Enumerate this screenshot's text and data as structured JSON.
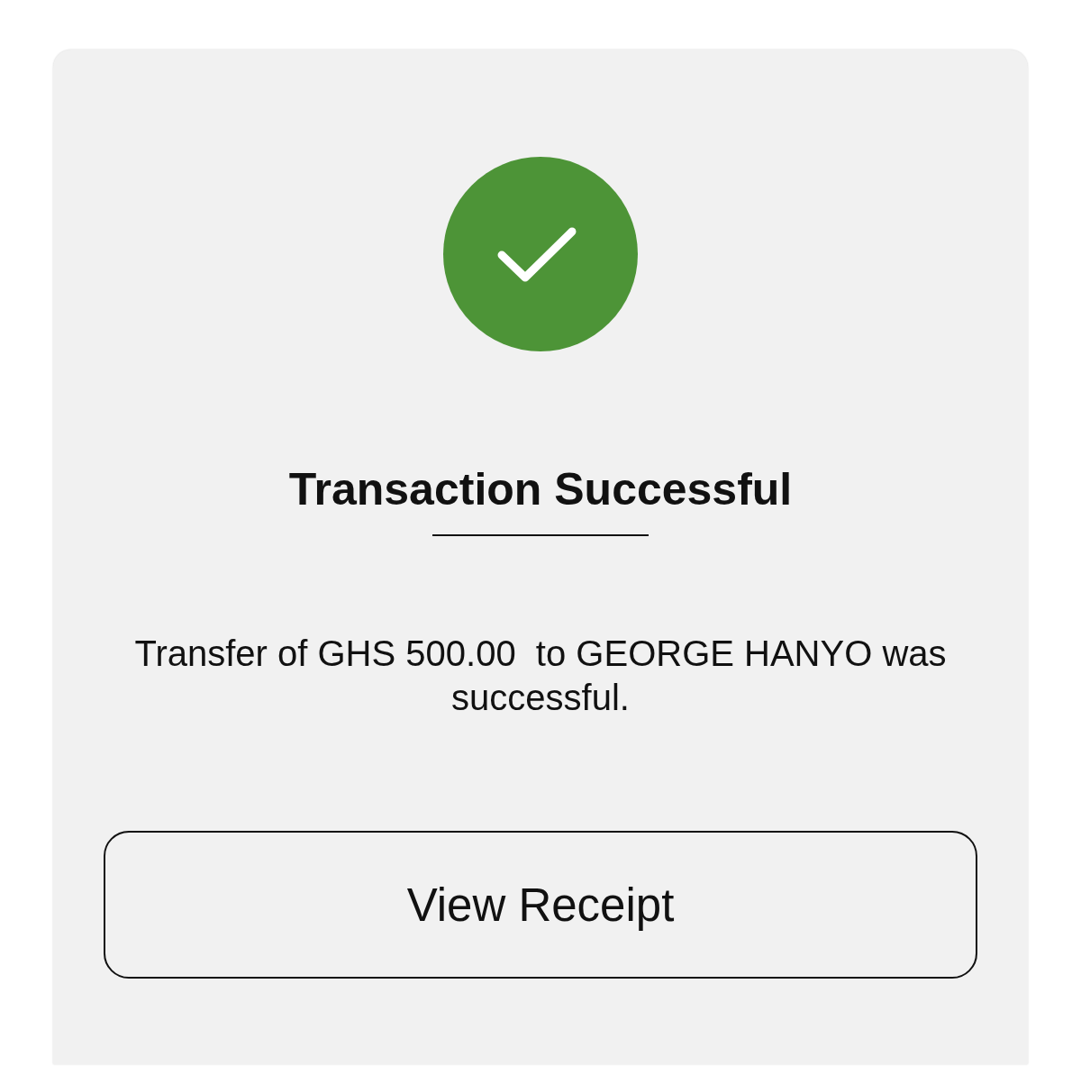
{
  "status": {
    "kind": "success"
  },
  "title": "Transaction Successful",
  "message": "Transfer of GHS 500.00  to GEORGE HANYO was successful.",
  "button": {
    "label": "View Receipt"
  }
}
